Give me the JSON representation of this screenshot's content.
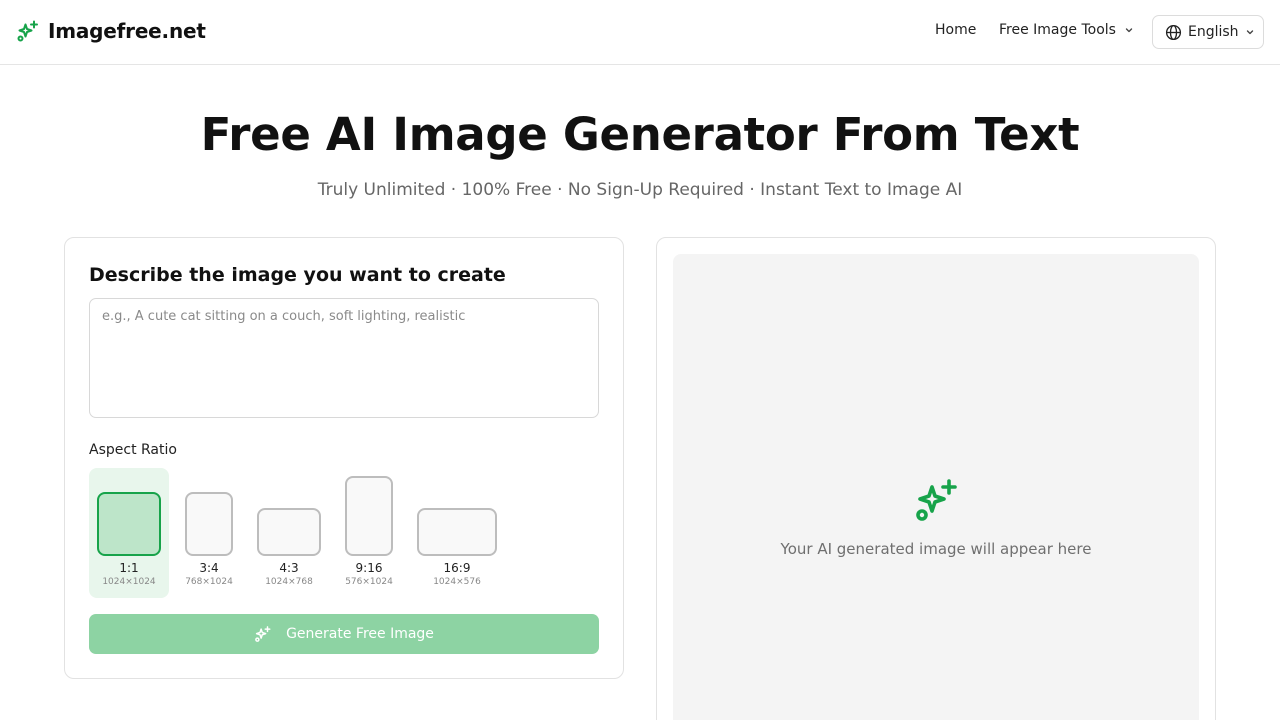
{
  "header": {
    "brand": "Imagefree.net",
    "logo_icon": "sparkle-icon",
    "nav": {
      "home": "Home",
      "tools": "Free Image Tools"
    },
    "language": "English"
  },
  "hero": {
    "title": "Free AI Image Generator From Text",
    "subtitle": "Truly Unlimited · 100% Free · No Sign-Up Required · Instant Text to Image AI"
  },
  "form": {
    "heading": "Describe the image you want to create",
    "prompt_value": "",
    "prompt_placeholder": "e.g., A cute cat sitting on a couch, soft lighting, realistic",
    "aspect_label": "Aspect Ratio",
    "aspect_options": [
      {
        "name": "1:1",
        "size": "1024×1024",
        "selected": true
      },
      {
        "name": "3:4",
        "size": "768×1024",
        "selected": false
      },
      {
        "name": "4:3",
        "size": "1024×768",
        "selected": false
      },
      {
        "name": "9:16",
        "size": "576×1024",
        "selected": false
      },
      {
        "name": "16:9",
        "size": "1024×576",
        "selected": false
      }
    ],
    "generate_label": "Generate Free Image"
  },
  "preview": {
    "placeholder_text": "Your AI generated image will appear here",
    "icon": "sparkle-icon"
  },
  "colors": {
    "accent": "#17a34a",
    "button_disabled": "#8dd3a3",
    "selected_bg": "#e8f6ec",
    "selected_fill": "#bde5c9",
    "preview_bg": "#f4f4f4"
  }
}
